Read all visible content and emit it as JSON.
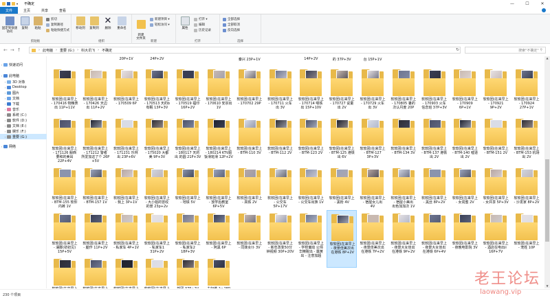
{
  "window": {
    "title": "不确定",
    "controls": [
      "—",
      "☐",
      "✕"
    ]
  },
  "tabs": [
    "文件",
    "主页",
    "共享",
    "查看"
  ],
  "ribbon": {
    "clipboard": {
      "label": "剪贴板",
      "pin": "固定到快速访问",
      "copy": "复制",
      "paste": "粘贴",
      "cut": "剪切",
      "copy_path": "复制路径",
      "paste_shortcut": "粘贴快捷方式"
    },
    "organize": {
      "label": "组织",
      "move_to": "移动到",
      "copy_to": "复制到",
      "delete": "删除",
      "rename": "重命名"
    },
    "new": {
      "label": "新建",
      "new_folder": "新建\n文件夹",
      "new_item": "新建项目 ▾",
      "easy_access": "轻松访问 ▾"
    },
    "open": {
      "label": "打开",
      "properties": "属性",
      "open": "打开 ▾",
      "edit": "编辑",
      "history": "历史记录"
    },
    "select": {
      "label": "选择",
      "select_all": "全部选择",
      "select_none": "全部取消",
      "invert": "反向选择"
    }
  },
  "address": {
    "crumbs": [
      "此电脑",
      "重要 (G:)",
      "科大讯飞",
      "不确定"
    ],
    "search_placeholder": "搜索\"不确定\""
  },
  "nav": [
    {
      "label": "快速访问",
      "level": 0
    },
    {
      "label": "此电脑",
      "level": 0
    },
    {
      "label": "3D 对象",
      "level": 1
    },
    {
      "label": "Desktop",
      "level": 1
    },
    {
      "label": "图片",
      "level": 1
    },
    {
      "label": "文档",
      "level": 1
    },
    {
      "label": "下载",
      "level": 1
    },
    {
      "label": "音乐",
      "level": 1
    },
    {
      "label": "系统 (C:)",
      "level": 1
    },
    {
      "label": "软件 (D:)",
      "level": 1
    },
    {
      "label": "文档 (E:)",
      "level": 1
    },
    {
      "label": "娱乐 (F:)",
      "level": 1
    },
    {
      "label": "重要 (G:)",
      "level": 1,
      "selected": true
    },
    {
      "label": "网络",
      "level": 0
    }
  ],
  "partial_top_labels": [
    "20P+1V",
    "24P+2V",
    "秦兴 23P+1V",
    "14P+2V",
    "的 37P+3V",
    "台 15P+1V"
  ],
  "rows": [
    [
      "软软团(在来早上\n- 170416 物粮表\n出 11P+11V",
      "软软团(在来早上\n- 170426 天边\n出 11P+2V",
      "软软团(在来早上\n- 170509 6P",
      "软软团(在来早上\n- 170513 天的b\n有眠 13P+3V",
      "软软团(在来早上\n- 170519 福印\n16P+2V",
      "软软团(在来早上\n- 170610 安宗出\n1V",
      "软软团(在来早上\n- 170702 29P",
      "软软团(在来早上\n- 170711 火车\n出 3V",
      "软软团(在来早上\n- 170714 嗯铁\n出 15P+10V",
      "软软团(在来早上\n- 170727 说童\n出 2V",
      "软软团(在来早上\n- 170729 火车\n出 3V",
      "软软团(在来早上\n- 170805 暑的\n次认月度 20P",
      "软软团(在来早上\n- 170903 火车\n信念班 37P+3V",
      "软软团(在来早上\n- 170909\n6P+1V",
      "软软团(在来早上\n- 170921\n9P+2V",
      "软软团(在来早上\n- 170924\n27P+1V"
    ],
    [
      "软软团(在来早上\n- 171126 服西\n要和的美出\n22P+4V",
      "软软团(在来早上\n- 171212 警者\n所爱加这了个 26P+5V",
      "软软团(在来早上\n- 171231 乐林\n出 23P+6V",
      "软软团(在来早上\n- 175020 大都\n美 9P+3V",
      "软软团(在来早上\n- 180117 天的\n出 的圆 21P+3V",
      "软软团(在来早上\n- 180214 KTV超\n饭滑班滑 12P+2V",
      "软软团(在来早上\n- BTM-110 3V",
      "软软团(在来早上\n- BTM-112 2V",
      "软软团(在来早上\n- BTM-123 2V",
      "软软团(在来早上\n- BTM-125 港铁\n出 6V",
      "软软团(在来早上\n- BTM-127\n3P+3V",
      "软软团(在来早上\n- BTM-134 3V",
      "软软团(在来早上\n- BTM-137 港铁\n出 2V",
      "软软团(在来早上\n- BTM-140 嘘道\n出 2V",
      "软软团(在来早上\n- BTM-151 2V",
      "软软团(在来早上\n- BTM-153 机场\n出 2V"
    ],
    [
      "软软团(在来早上\n- BTM-155 软你\n内裤 1V",
      "软软团(在来早上\n- BTM-157 1V",
      "软软团(在来早上\n- 我上 3P+1V",
      "软软团(在来早上\n- 大小姐的冒纹\n的景 23p+2v",
      "软软团(在来早上\n- 地铁 5V",
      "软软团(在来早上\n- 放学后教室\n6P+5V",
      "软软团(在来早上\n- 高铁 2V",
      "软软团(在来早上\n- 公交车\n5P+17V",
      "软软团(在来早上\n- 公交车出族 1V",
      "软软团(在来早上\n- 黑粉 4V",
      "软软团(在来早上\n- 宿屋女儿出\n4V",
      "软软团(在来早上\n- 宿屋小美出\n出色加加次 1V",
      "软软团(在来早上\n- 黑丝 8P+2V",
      "软软团(在来早上\n- 女闺蜜 2V",
      "软软团(在来早上\n- 女共享 5P+3V",
      "软软团(在来早上\n- 沙发家 8P+2V"
    ],
    [
      "软软团(在来早上\n- 濡脚(初初见)\n15P+5V",
      "软软团(在来早上\n- 腿作 11P+2V",
      "软软团(在来早上\n- 私家车 4P+1V",
      "软软团(在来早上\n- 私家车1\n31P+2V",
      "软软团(在来早上\n- 私家车2\n18P+3V",
      "软软团(在来早上\n- 阿黑 6P",
      "软软团(在来早上\n- 同妹女仆 3V",
      "软软团(在来早上\n- 新年改变50分\n钟视频 30P+20V",
      "软软团(在来早上\n- 学校偏动 公师\n华精致出 - 露黄\n出 - 注意加超",
      "软软团(在来早上\n- 夜景佳美次出\n在港铁 8P+2V",
      "软软团(在来早上\n- 夜景佳美次出\n在港铁 7P+2V",
      "软软团(在来早上\n- 夜景大女佳出\n在港铁 9P+2V",
      "软软团(在来早上\n- 夜景大女佳出\n在港铁 6P+4V",
      "软软团(在来早上\n- 夜晚电影院 3V",
      "软软团(在来早上\n- 酒店在电出ii\n16P+7V",
      "软软团(在来早上\n- 宠姓 10P"
    ],
    [
      "软软团(在来早上\n- 罗阿系 2V",
      "软软团(在来早上\n- 罗阿门",
      "软软团(在来早上\n- 在午米阵",
      "软软团(在来早上\n- 在宾馆服服务\n在开开服位平",
      "新团 37P+2V",
      "夫妇维 1v 28P"
    ]
  ],
  "highlighted": {
    "row": 3,
    "col": 9
  },
  "paper_colors": [
    "#3a3f55",
    "#d9dce6",
    "#8b94ad",
    "#c9b9b0",
    "#2d2d35",
    "#9aa4bd",
    "#e6e1e3",
    "#4a5068",
    "#b7a7a3",
    "#6d7590",
    "#1f2230",
    "#cfd4e0"
  ],
  "status": {
    "count": "230 个项目"
  },
  "watermark": {
    "cn": "老王论坛",
    "en": "laowang.vip"
  }
}
